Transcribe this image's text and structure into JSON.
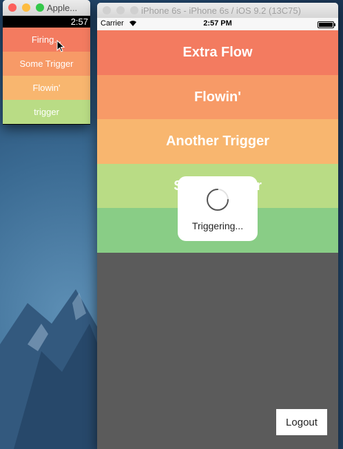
{
  "watch_window": {
    "title": "Apple...",
    "time": "2:57",
    "rows": [
      {
        "label": "Firing..."
      },
      {
        "label": "Some Trigger"
      },
      {
        "label": "Flowin'"
      },
      {
        "label": "trigger"
      }
    ]
  },
  "simulator_window": {
    "title": "iPhone 6s - iPhone 6s / iOS 9.2 (13C75)",
    "status_bar": {
      "carrier": "Carrier",
      "time": "2:57 PM"
    },
    "rows": [
      {
        "label": "Extra Flow"
      },
      {
        "label": "Flowin'"
      },
      {
        "label": "Another Trigger"
      },
      {
        "label": "Some Trigger"
      },
      {
        "label": ""
      }
    ],
    "hud": {
      "text": "Triggering..."
    },
    "logout_label": "Logout"
  },
  "colors": {
    "red": "#f37b60",
    "orange": "#f79a67",
    "amber": "#f8b66f",
    "lime": "#b9dc85",
    "green": "#89cd86",
    "background_gray": "#5b5b5b"
  }
}
